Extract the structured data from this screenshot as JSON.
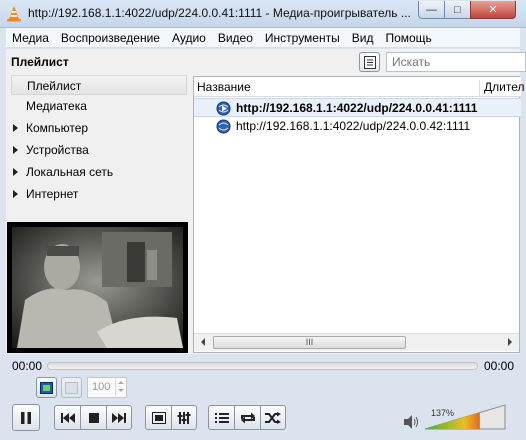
{
  "window": {
    "title": "http://192.168.1.1:4022/udp/224.0.0.41:1111 - Медиа-проигрыватель ...",
    "min_symbol": "—",
    "max_symbol": "□",
    "close_symbol": "✕"
  },
  "menubar": [
    "Медиа",
    "Воспроизведение",
    "Аудио",
    "Видео",
    "Инструменты",
    "Вид",
    "Помощь"
  ],
  "playlist": {
    "title": "Плейлист",
    "search_placeholder": "Искать",
    "sidebar": [
      {
        "label": "Плейлист",
        "selected": true,
        "expandable": false
      },
      {
        "label": "Медиатека",
        "selected": false,
        "expandable": false
      },
      {
        "label": "Компьютер",
        "selected": false,
        "expandable": true
      },
      {
        "label": "Устройства",
        "selected": false,
        "expandable": true
      },
      {
        "label": "Локальная сеть",
        "selected": false,
        "expandable": true
      },
      {
        "label": "Интернет",
        "selected": false,
        "expandable": true
      }
    ],
    "columns": {
      "name": "Название",
      "duration": "Длител"
    },
    "items": [
      {
        "url": "http://192.168.1.1:4022/udp/224.0.0.41:1111",
        "playing": true
      },
      {
        "url": "http://192.168.1.1:4022/udp/224.0.0.42:1111",
        "playing": false
      }
    ],
    "scroll_grip": "III"
  },
  "playback": {
    "time_elapsed": "00:00",
    "time_total": "00:00",
    "zoom_value": "100",
    "volume_percent": "137%",
    "volume_level": 1.37
  },
  "colors": {
    "accent": "#3a6fc4",
    "selection_bg": "#e8f0fa",
    "volume_low": "#3ab53a",
    "volume_high": "#e8c020"
  }
}
